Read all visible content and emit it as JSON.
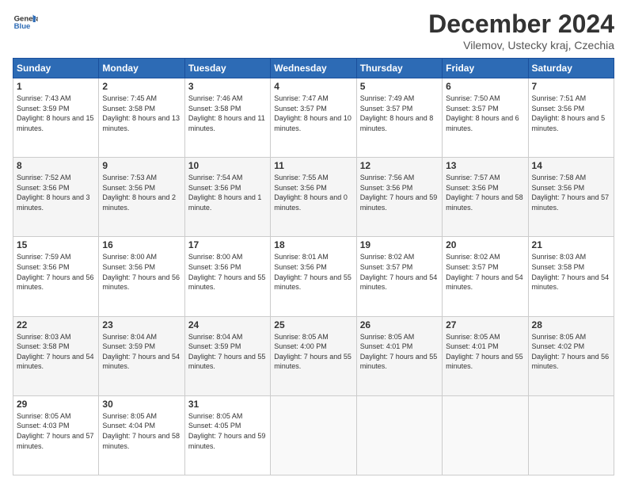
{
  "header": {
    "logo_line1": "General",
    "logo_line2": "Blue",
    "month_title": "December 2024",
    "location": "Vilemov, Ustecky kraj, Czechia"
  },
  "weekdays": [
    "Sunday",
    "Monday",
    "Tuesday",
    "Wednesday",
    "Thursday",
    "Friday",
    "Saturday"
  ],
  "weeks": [
    [
      {
        "day": "1",
        "sunrise": "7:43 AM",
        "sunset": "3:59 PM",
        "daylight": "8 hours and 15 minutes."
      },
      {
        "day": "2",
        "sunrise": "7:45 AM",
        "sunset": "3:58 PM",
        "daylight": "8 hours and 13 minutes."
      },
      {
        "day": "3",
        "sunrise": "7:46 AM",
        "sunset": "3:58 PM",
        "daylight": "8 hours and 11 minutes."
      },
      {
        "day": "4",
        "sunrise": "7:47 AM",
        "sunset": "3:57 PM",
        "daylight": "8 hours and 10 minutes."
      },
      {
        "day": "5",
        "sunrise": "7:49 AM",
        "sunset": "3:57 PM",
        "daylight": "8 hours and 8 minutes."
      },
      {
        "day": "6",
        "sunrise": "7:50 AM",
        "sunset": "3:57 PM",
        "daylight": "8 hours and 6 minutes."
      },
      {
        "day": "7",
        "sunrise": "7:51 AM",
        "sunset": "3:56 PM",
        "daylight": "8 hours and 5 minutes."
      }
    ],
    [
      {
        "day": "8",
        "sunrise": "7:52 AM",
        "sunset": "3:56 PM",
        "daylight": "8 hours and 3 minutes."
      },
      {
        "day": "9",
        "sunrise": "7:53 AM",
        "sunset": "3:56 PM",
        "daylight": "8 hours and 2 minutes."
      },
      {
        "day": "10",
        "sunrise": "7:54 AM",
        "sunset": "3:56 PM",
        "daylight": "8 hours and 1 minute."
      },
      {
        "day": "11",
        "sunrise": "7:55 AM",
        "sunset": "3:56 PM",
        "daylight": "8 hours and 0 minutes."
      },
      {
        "day": "12",
        "sunrise": "7:56 AM",
        "sunset": "3:56 PM",
        "daylight": "7 hours and 59 minutes."
      },
      {
        "day": "13",
        "sunrise": "7:57 AM",
        "sunset": "3:56 PM",
        "daylight": "7 hours and 58 minutes."
      },
      {
        "day": "14",
        "sunrise": "7:58 AM",
        "sunset": "3:56 PM",
        "daylight": "7 hours and 57 minutes."
      }
    ],
    [
      {
        "day": "15",
        "sunrise": "7:59 AM",
        "sunset": "3:56 PM",
        "daylight": "7 hours and 56 minutes."
      },
      {
        "day": "16",
        "sunrise": "8:00 AM",
        "sunset": "3:56 PM",
        "daylight": "7 hours and 56 minutes."
      },
      {
        "day": "17",
        "sunrise": "8:00 AM",
        "sunset": "3:56 PM",
        "daylight": "7 hours and 55 minutes."
      },
      {
        "day": "18",
        "sunrise": "8:01 AM",
        "sunset": "3:56 PM",
        "daylight": "7 hours and 55 minutes."
      },
      {
        "day": "19",
        "sunrise": "8:02 AM",
        "sunset": "3:57 PM",
        "daylight": "7 hours and 54 minutes."
      },
      {
        "day": "20",
        "sunrise": "8:02 AM",
        "sunset": "3:57 PM",
        "daylight": "7 hours and 54 minutes."
      },
      {
        "day": "21",
        "sunrise": "8:03 AM",
        "sunset": "3:58 PM",
        "daylight": "7 hours and 54 minutes."
      }
    ],
    [
      {
        "day": "22",
        "sunrise": "8:03 AM",
        "sunset": "3:58 PM",
        "daylight": "7 hours and 54 minutes."
      },
      {
        "day": "23",
        "sunrise": "8:04 AM",
        "sunset": "3:59 PM",
        "daylight": "7 hours and 54 minutes."
      },
      {
        "day": "24",
        "sunrise": "8:04 AM",
        "sunset": "3:59 PM",
        "daylight": "7 hours and 55 minutes."
      },
      {
        "day": "25",
        "sunrise": "8:05 AM",
        "sunset": "4:00 PM",
        "daylight": "7 hours and 55 minutes."
      },
      {
        "day": "26",
        "sunrise": "8:05 AM",
        "sunset": "4:01 PM",
        "daylight": "7 hours and 55 minutes."
      },
      {
        "day": "27",
        "sunrise": "8:05 AM",
        "sunset": "4:01 PM",
        "daylight": "7 hours and 55 minutes."
      },
      {
        "day": "28",
        "sunrise": "8:05 AM",
        "sunset": "4:02 PM",
        "daylight": "7 hours and 56 minutes."
      }
    ],
    [
      {
        "day": "29",
        "sunrise": "8:05 AM",
        "sunset": "4:03 PM",
        "daylight": "7 hours and 57 minutes."
      },
      {
        "day": "30",
        "sunrise": "8:05 AM",
        "sunset": "4:04 PM",
        "daylight": "7 hours and 58 minutes."
      },
      {
        "day": "31",
        "sunrise": "8:05 AM",
        "sunset": "4:05 PM",
        "daylight": "7 hours and 59 minutes."
      },
      null,
      null,
      null,
      null
    ]
  ]
}
